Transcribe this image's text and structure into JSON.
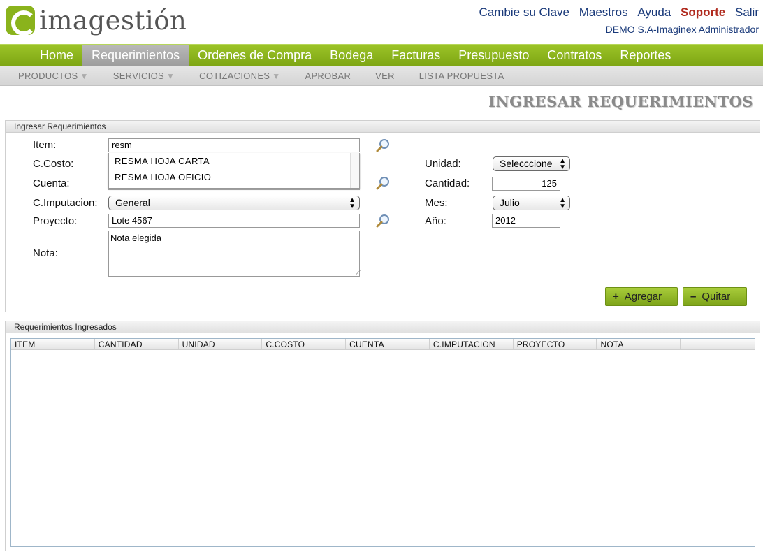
{
  "header": {
    "logo_text": "imagestión",
    "links": {
      "change_password": "Cambie su Clave",
      "maestros": "Maestros",
      "ayuda": "Ayuda",
      "soporte": "Soporte",
      "salir": "Salir"
    },
    "user": "DEMO S.A-Imaginex Administrador",
    "colors": {
      "brand_green": "#8ab31c",
      "link": "#1a3a7a",
      "soporte": "#b02a1e"
    }
  },
  "nav": {
    "items": [
      "Home",
      "Requerimientos",
      "Ordenes de Compra",
      "Bodega",
      "Facturas",
      "Presupuesto",
      "Contratos",
      "Reportes"
    ],
    "active": "Requerimientos"
  },
  "subnav": {
    "productos": "PRODUCTOS",
    "servicios": "SERVICIOS",
    "cotizaciones": "COTIZACIONES",
    "aprobar": "APROBAR",
    "ver": "VER",
    "lista": "LISTA PROPUESTA"
  },
  "page_title": "INGRESAR REQUERIMIENTOS",
  "form": {
    "panel_title": "Ingresar Requerimientos",
    "labels": {
      "item": "Item:",
      "ccosto": "C.Costo:",
      "cuenta": "Cuenta:",
      "cimputacion": "C.Imputacion:",
      "proyecto": "Proyecto:",
      "nota": "Nota:",
      "unidad": "Unidad:",
      "cantidad": "Cantidad:",
      "mes": "Mes:",
      "anio": "Año:"
    },
    "values": {
      "item": "resm",
      "cimputacion": "General",
      "proyecto": "Lote 4567",
      "nota": "Nota elegida",
      "unidad": "Selecccione",
      "cantidad": "125",
      "mes": "Julio",
      "anio": "2012"
    },
    "autocomplete": [
      "RESMA HOJA CARTA",
      "RESMA HOJA OFICIO"
    ],
    "buttons": {
      "agregar": "Agregar",
      "quitar": "Quitar"
    }
  },
  "grid": {
    "panel_title": "Requerimientos Ingresados",
    "columns": [
      "ITEM",
      "CANTIDAD",
      "UNIDAD",
      "C.COSTO",
      "CUENTA",
      "C.IMPUTACION",
      "PROYECTO",
      "NOTA"
    ]
  }
}
